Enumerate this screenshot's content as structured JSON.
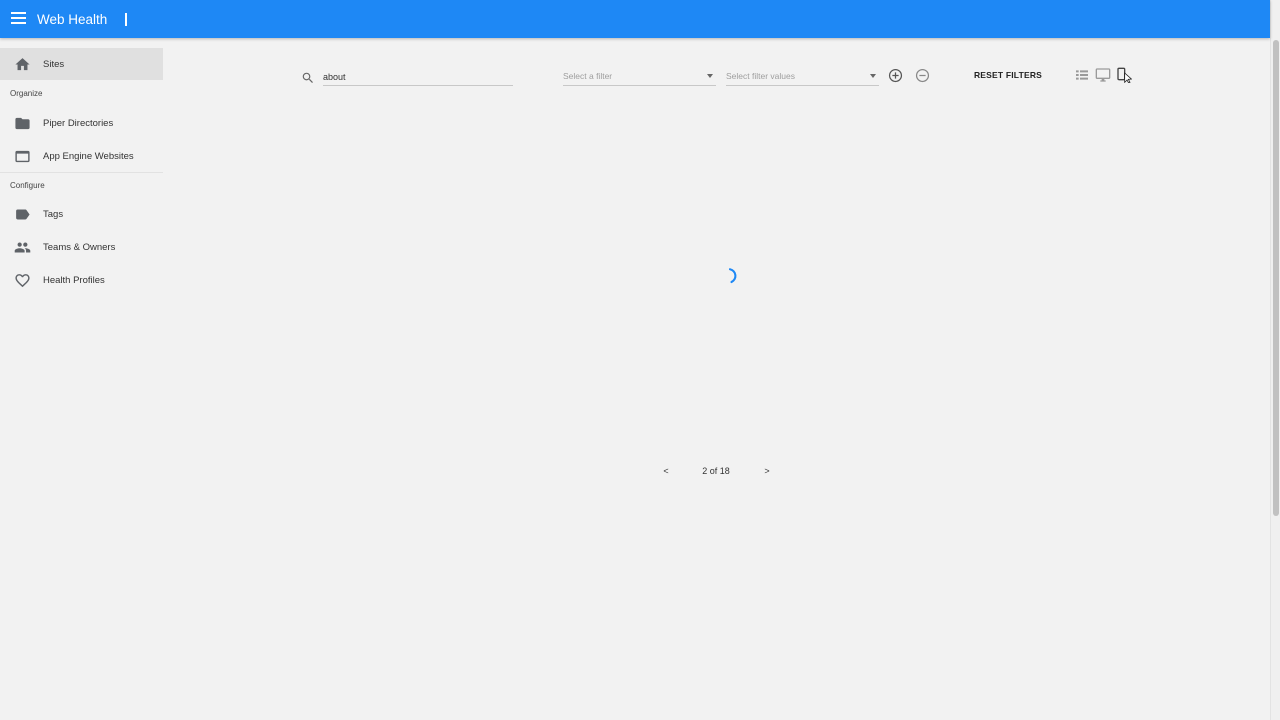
{
  "app": {
    "title": "Web Health"
  },
  "sidebar": {
    "sites": "Sites",
    "sections": {
      "organize": "Organize",
      "configure": "Configure"
    },
    "items": {
      "piper": "Piper Directories",
      "appengine": "App Engine Websites",
      "tags": "Tags",
      "teams": "Teams & Owners",
      "health": "Health Profiles"
    }
  },
  "toolbar": {
    "search_value": "about",
    "filter_placeholder": "Select a filter",
    "values_placeholder": "Select filter values",
    "reset_label": "RESET FILTERS"
  },
  "pager": {
    "prev": "<",
    "text": "2 of 18",
    "next": ">"
  },
  "colors": {
    "brand": "#1e88f5",
    "accent_spinner": "#1e88f5"
  },
  "icons": [
    "menu-icon",
    "home-icon",
    "folder-icon",
    "window-icon",
    "label-icon",
    "people-icon",
    "heart-icon",
    "search-icon",
    "add-circle-icon",
    "remove-circle-icon",
    "list-view-icon",
    "desktop-view-icon",
    "mobile-view-icon"
  ]
}
